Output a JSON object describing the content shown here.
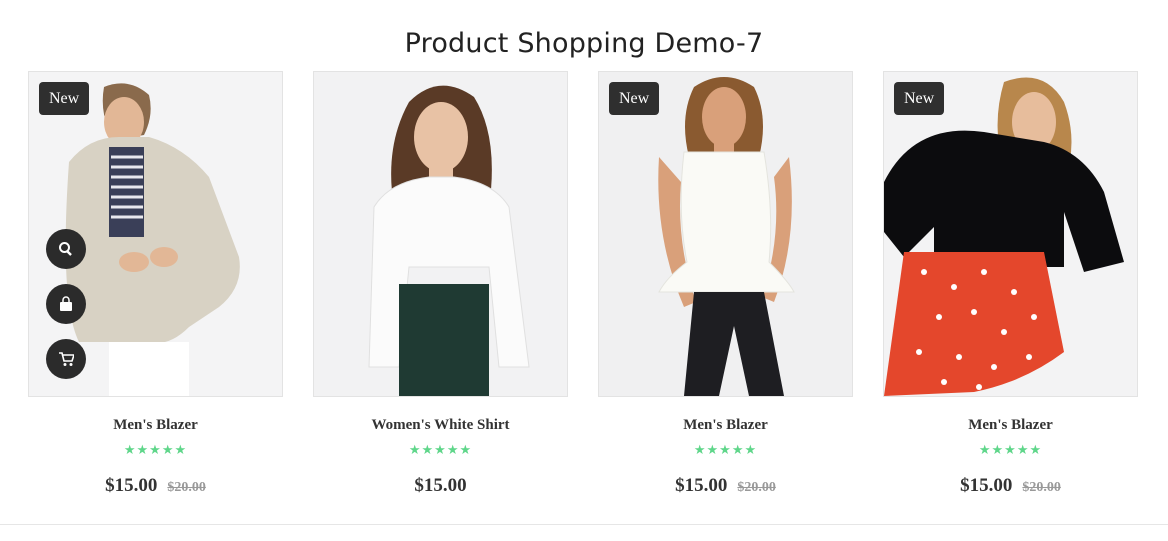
{
  "page": {
    "title": "Product Shopping Demo-7"
  },
  "products": [
    {
      "name": "Men's Blazer",
      "badge": "New",
      "stars": "★★★★★",
      "rating": 5,
      "price": "$15.00",
      "old_price": "$20.00"
    },
    {
      "name": "Women's White Shirt",
      "badge": "",
      "stars": "★★★★★",
      "rating": 5,
      "price": "$15.00",
      "old_price": ""
    },
    {
      "name": "Men's Blazer",
      "badge": "New",
      "stars": "★★★★★",
      "rating": 5,
      "price": "$15.00",
      "old_price": "$20.00"
    },
    {
      "name": "Men's Blazer",
      "badge": "New",
      "stars": "★★★★★",
      "rating": 5,
      "price": "$15.00",
      "old_price": "$20.00"
    }
  ],
  "actions": [
    {
      "icon": "search-icon"
    },
    {
      "icon": "shopping-bag-icon"
    },
    {
      "icon": "shopping-cart-icon"
    }
  ],
  "colors": {
    "star": "#5fd68a",
    "badge_bg": "#2f2f2f",
    "action_bg": "#2b2b2b"
  }
}
